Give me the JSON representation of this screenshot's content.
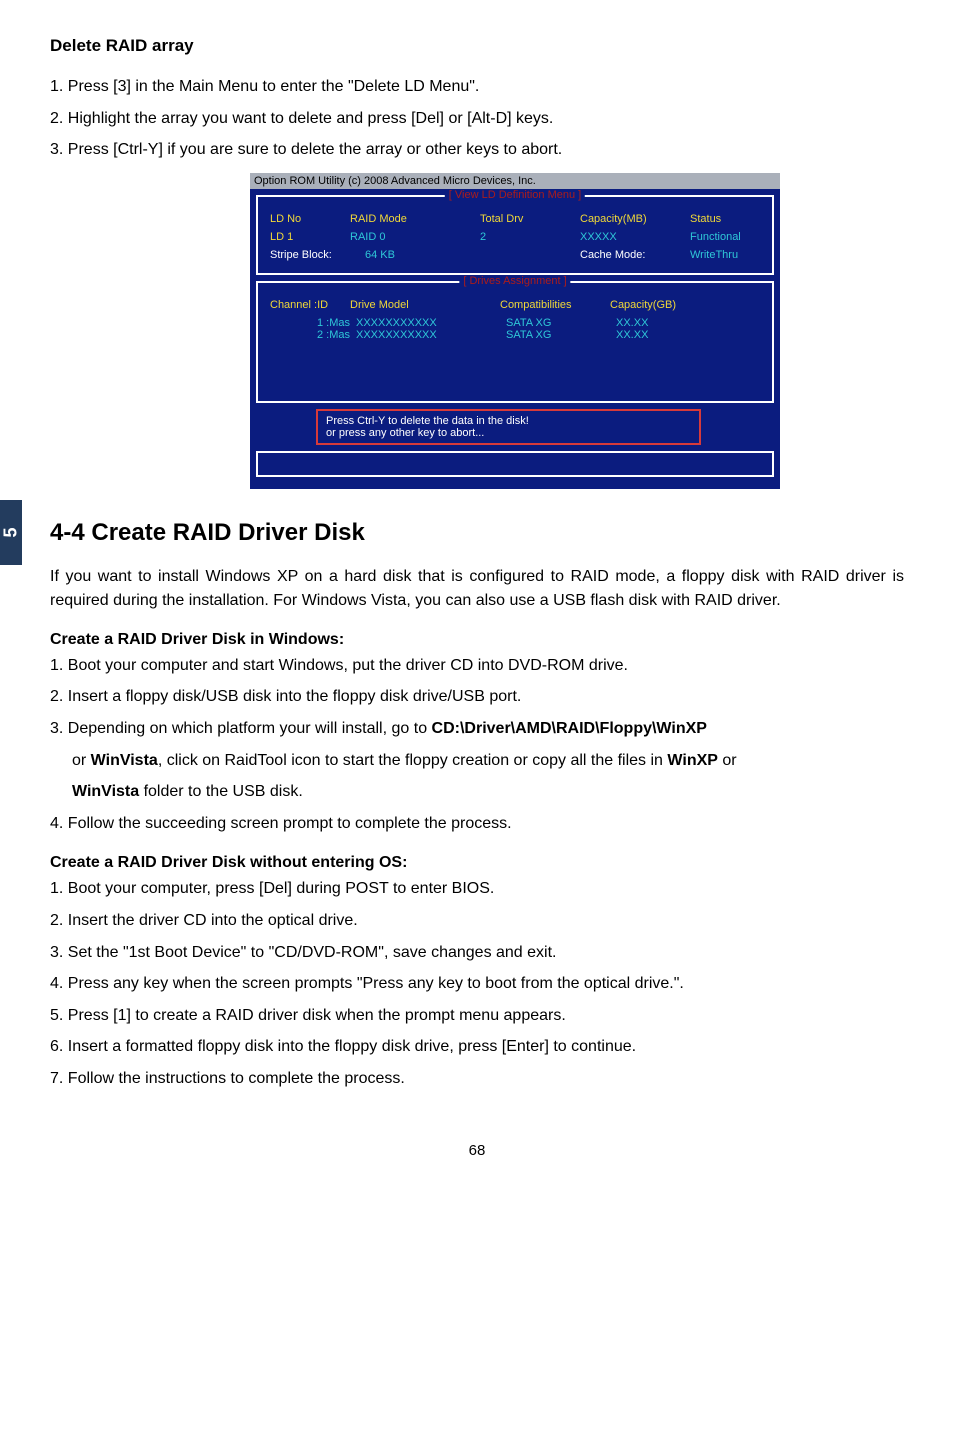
{
  "sideTab": "5",
  "sec1_title": "Delete RAID array",
  "sec1_steps": [
    "1. Press [3] in the Main Menu to enter the \"Delete LD Menu\".",
    "2. Highlight the array you want to delete and press [Del] or [Alt-D] keys.",
    "3. Press [Ctrl-Y] if you are sure to delete the array or other keys to abort."
  ],
  "bios": {
    "caption": "Option ROM Utility (c) 2008 Advanced Micro Devices, Inc.",
    "panel1_title": "[ View LD Definition Menu ]",
    "h_ldno": "LD No",
    "h_raidmode": "RAID Mode",
    "h_totaldrv": "Total Drv",
    "h_capmb": "Capacity(MB)",
    "h_status": "Status",
    "v_ld": "LD  1",
    "v_mode": "RAID 0",
    "v_drv": "2",
    "v_cap": "XXXXX",
    "v_stat": "Functional",
    "h_stripe": "Stripe Block:",
    "v_stripe": "64   KB",
    "h_cache": "Cache Mode:",
    "v_cache": "WriteThru",
    "panel2_title": "[ Drives Assignment ]",
    "h_chan": "Channel  :ID",
    "h_drvmodel": "Drive Model",
    "h_compat": "Compatibilities",
    "h_capgb": "Capacity(GB)",
    "r1_chan": "1 :Mas",
    "r1_model": "XXXXXXXXXXX",
    "r1_compat": "SATA  XG",
    "r1_cap": "XX.XX",
    "r2_chan": "2 :Mas",
    "r2_model": "XXXXXXXXXXX",
    "r2_compat": "SATA  XG",
    "r2_cap": "XX.XX",
    "alert1": "Press Ctrl-Y to delete the data in the disk!",
    "alert2": "or press any other key to abort..."
  },
  "sec2_title": "4-4 Create RAID Driver Disk",
  "sec2_para": "If you want to install Windows XP on a hard disk that is configured to RAID mode, a floppy disk with RAID driver is required during the installation. For Windows Vista, you can also use a USB flash disk with RAID driver.",
  "sub1_title": "Create a RAID Driver Disk in Windows:",
  "sub1_steps": {
    "s1": "1. Boot your computer and start Windows, put the driver CD into DVD-ROM drive.",
    "s2": "2. Insert a floppy disk/USB disk into the floppy disk drive/USB port.",
    "s3a": "3. Depending on which platform your will install, go to ",
    "s3b_bold": "CD:\\Driver\\AMD\\RAID\\Floppy\\WinXP",
    "s3c": "or ",
    "s3c_bold": "WinVista",
    "s3d": ", click on RaidTool icon to start the floppy creation or copy all the files in ",
    "s3d_bold": "WinXP",
    "s3e": " or ",
    "s3f_bold": "WinVista",
    "s3g": " folder to the USB disk.",
    "s4": "4. Follow the succeeding screen prompt to complete the process."
  },
  "sub2_title": "Create a RAID Driver Disk without entering OS:",
  "sub2_steps": [
    "1. Boot your computer, press [Del] during POST to enter BIOS.",
    "2. Insert the driver CD into the optical drive.",
    "3. Set the \"1st Boot Device\" to \"CD/DVD-ROM\", save changes and exit.",
    "4. Press any key when the screen prompts \"Press any key to boot from the optical drive.\".",
    "5. Press [1] to create a RAID driver disk when the prompt menu appears.",
    "6. Insert a formatted floppy disk into the floppy disk drive, press [Enter] to continue.",
    "7. Follow the instructions to complete the process."
  ],
  "pageNum": "68"
}
